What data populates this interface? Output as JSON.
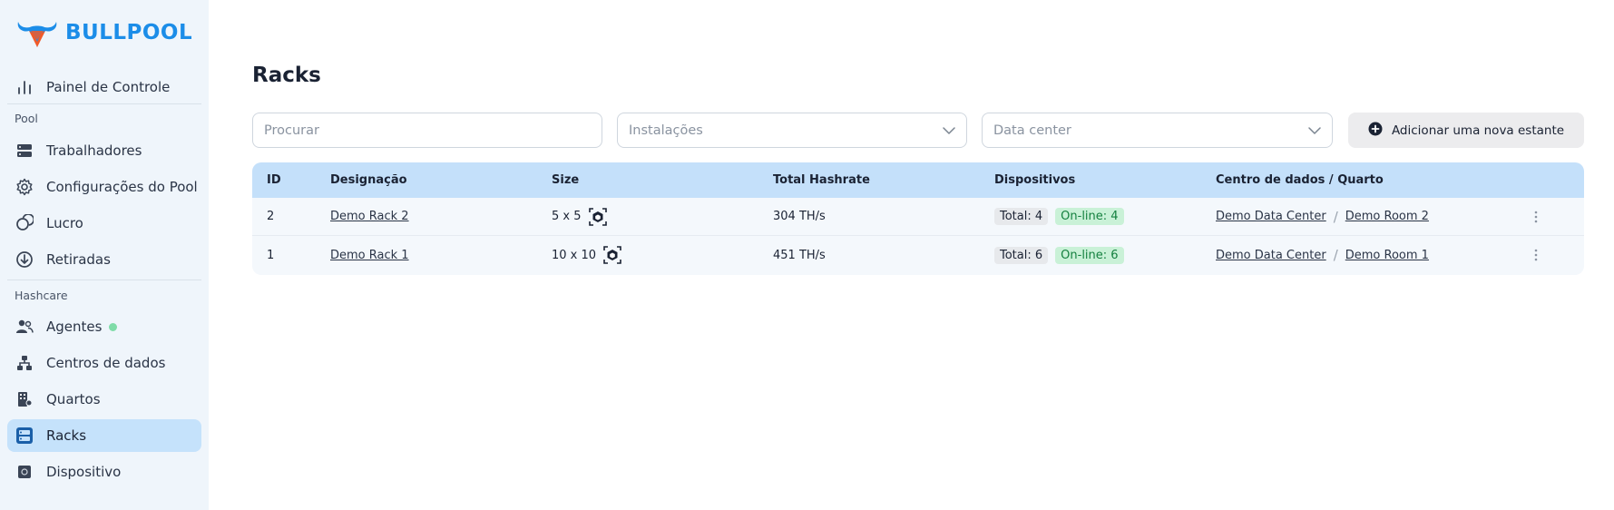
{
  "brand": {
    "name": "BULLPOOL",
    "accent": "#1c8de8",
    "logo_secondary": "#f15a29"
  },
  "sidebar": {
    "top_item": {
      "label": "Painel de Controle",
      "icon": "bar-chart-icon"
    },
    "sections": [
      {
        "label": "Pool",
        "items": [
          {
            "label": "Trabalhadores",
            "icon": "server-icon"
          },
          {
            "label": "Configurações do Pool",
            "icon": "gear-icon"
          },
          {
            "label": "Lucro",
            "icon": "coins-icon"
          },
          {
            "label": "Retiradas",
            "icon": "download-circle-icon"
          }
        ]
      },
      {
        "label": "Hashcare",
        "items": [
          {
            "label": "Agentes",
            "icon": "users-icon",
            "status": "online"
          },
          {
            "label": "Centros de dados",
            "icon": "hierarchy-icon"
          },
          {
            "label": "Quartos",
            "icon": "building-icon"
          },
          {
            "label": "Racks",
            "icon": "rack-icon",
            "active": true
          },
          {
            "label": "Dispositivo",
            "icon": "chip-icon"
          }
        ]
      }
    ]
  },
  "page": {
    "title": "Racks"
  },
  "filters": {
    "search_placeholder": "Procurar",
    "installations_placeholder": "Instalações",
    "datacenter_placeholder": "Data center",
    "add_button_label": "Adicionar uma nova estante"
  },
  "table": {
    "headers": [
      "ID",
      "Designação",
      "Size",
      "Total Hashrate",
      "Dispositivos",
      "Centro de dados / Quarto"
    ],
    "rows": [
      {
        "id": "2",
        "name": "Demo Rack 2",
        "size": "5 x 5",
        "hashrate": "304 TH/s",
        "total": "Total: 4",
        "online": "On-line: 4",
        "datacenter": "Demo Data Center",
        "room": "Demo Room 2"
      },
      {
        "id": "1",
        "name": "Demo Rack 1",
        "size": "10 x 10",
        "hashrate": "451 TH/s",
        "total": "Total: 6",
        "online": "On-line: 6",
        "datacenter": "Demo Data Center",
        "room": "Demo Room 1"
      }
    ]
  }
}
